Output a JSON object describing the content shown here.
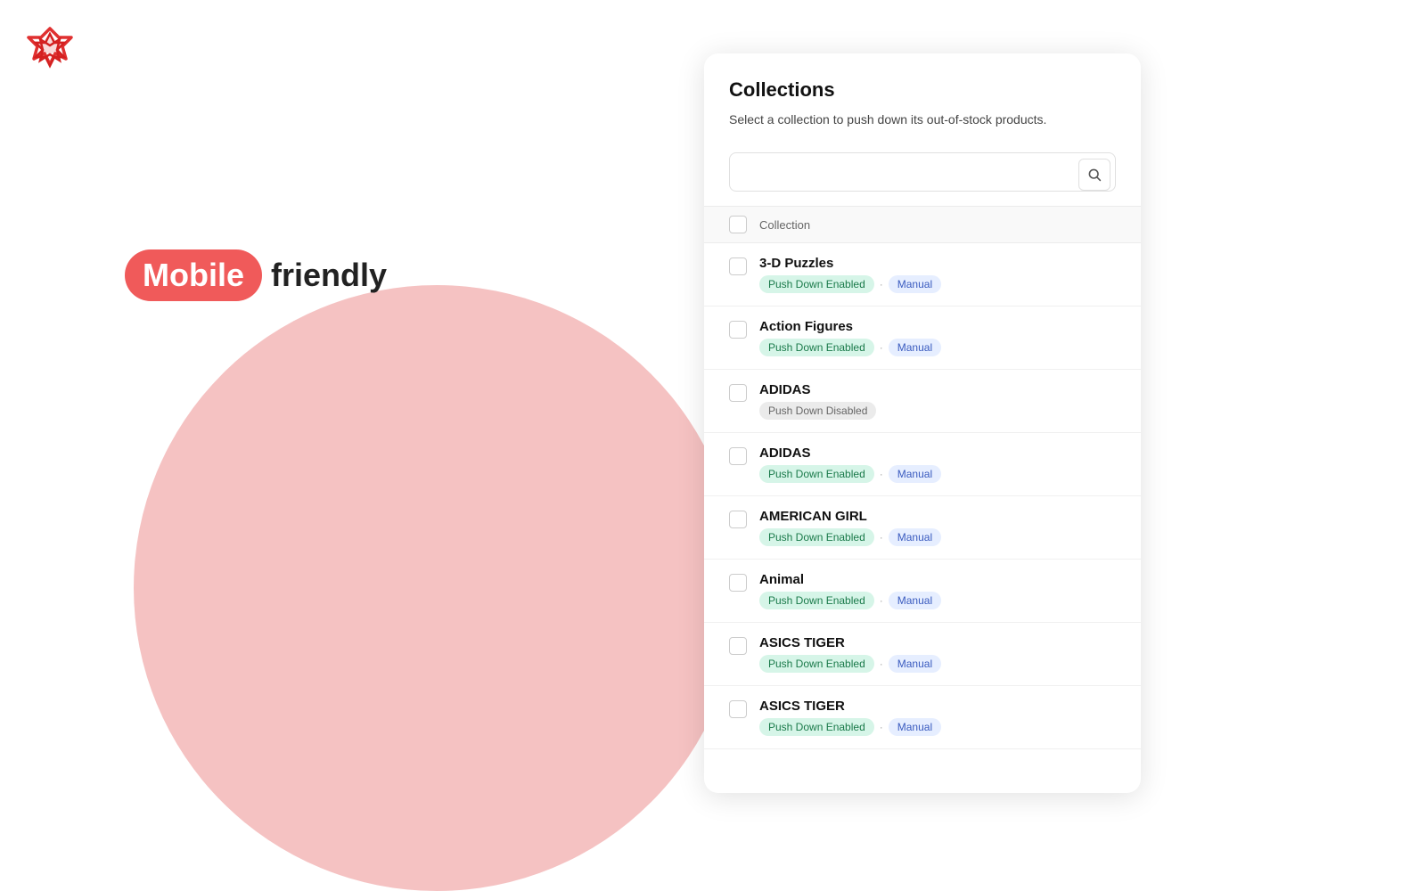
{
  "logo": {
    "alt": "App Logo"
  },
  "hero": {
    "mobile_label": "Mobile",
    "friendly_label": "friendly"
  },
  "panel": {
    "title": "Collections",
    "description": "Select a collection to push down its out-of-stock products.",
    "search_placeholder": "",
    "table_header_label": "Collection",
    "collections": [
      {
        "id": 1,
        "name": "3-D Puzzles",
        "status": "enabled",
        "status_label": "Push Down Enabled",
        "mode": "Manual",
        "checked": false
      },
      {
        "id": 2,
        "name": "Action Figures",
        "status": "enabled",
        "status_label": "Push Down Enabled",
        "mode": "Manual",
        "checked": false
      },
      {
        "id": 3,
        "name": "ADIDAS",
        "status": "disabled",
        "status_label": "Push Down Disabled",
        "mode": null,
        "checked": false
      },
      {
        "id": 4,
        "name": "ADIDAS",
        "status": "enabled",
        "status_label": "Push Down Enabled",
        "mode": "Manual",
        "checked": false
      },
      {
        "id": 5,
        "name": "AMERICAN GIRL",
        "status": "enabled",
        "status_label": "Push Down Enabled",
        "mode": "Manual",
        "checked": false
      },
      {
        "id": 6,
        "name": "Animal",
        "status": "enabled",
        "status_label": "Push Down Enabled",
        "mode": "Manual",
        "checked": false
      },
      {
        "id": 7,
        "name": "ASICS TIGER",
        "status": "enabled",
        "status_label": "Push Down Enabled",
        "mode": "Manual",
        "checked": false
      },
      {
        "id": 8,
        "name": "ASICS TIGER",
        "status": "enabled",
        "status_label": "Push Down Enabled",
        "mode": "Manual",
        "checked": false
      }
    ]
  }
}
